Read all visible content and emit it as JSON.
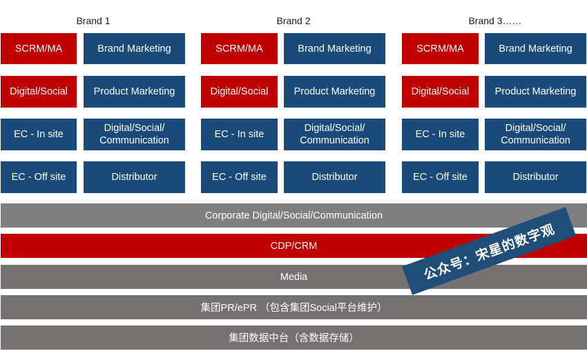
{
  "colors": {
    "red": "#c00000",
    "blue": "#1f4e79",
    "gray_light": "#7f7f7f",
    "gray_dark": "#767171",
    "banner": "#1f4e79"
  },
  "brands": [
    {
      "title": "Brand 1",
      "left_column": [
        "SCRM/MA",
        "Digital/Social",
        "EC - In site",
        "EC - Off site"
      ],
      "right_column": [
        "Brand Marketing",
        "Product Marketing",
        "Digital/Social/\nCommunication",
        "Distributor"
      ]
    },
    {
      "title": "Brand 2",
      "left_column": [
        "SCRM/MA",
        "Digital/Social",
        "EC - In site",
        "EC - Off site"
      ],
      "right_column": [
        "Brand Marketing",
        "Product Marketing",
        "Digital/Social/\nCommunication",
        "Distributor"
      ]
    },
    {
      "title": "Brand 3……",
      "left_column": [
        "SCRM/MA",
        "Digital/Social",
        "EC - In site",
        "EC - Off site"
      ],
      "right_column": [
        "Brand Marketing",
        "Product Marketing",
        "Digital/Social/\nCommunication",
        "Distributor"
      ]
    }
  ],
  "layers": [
    {
      "label": "Corporate Digital/Social/Communication",
      "color": "gray_light"
    },
    {
      "label": "CDP/CRM",
      "color": "red"
    },
    {
      "label": "Media",
      "color": "gray_dark"
    },
    {
      "label": "集团PR/ePR （包含集团Social平台维护）",
      "color": "gray_dark"
    },
    {
      "label": "集团数据中台（含数据存储）",
      "color": "gray_dark"
    }
  ],
  "watermark": {
    "text": "公众号：宋星的数字观"
  }
}
